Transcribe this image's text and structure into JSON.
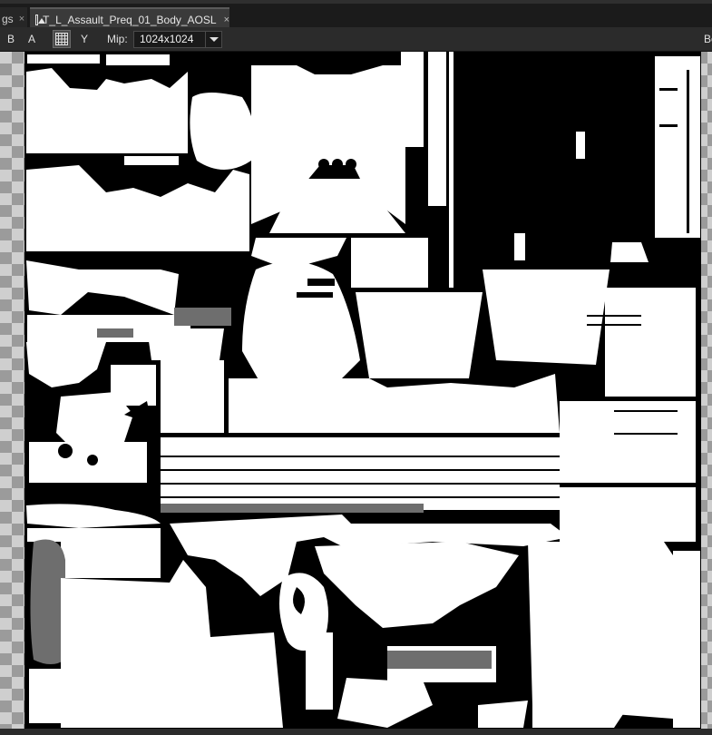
{
  "tabs": {
    "previous": {
      "label": "gs",
      "close": "×"
    },
    "active": {
      "label": "T_L_Assault_Preq_01_Body_AOSL",
      "close": "×",
      "icon": "image-icon"
    }
  },
  "toolbar": {
    "channel_b": "B",
    "channel_a": "A",
    "grid_toggle_icon": "grid-icon",
    "channel_y": "Y",
    "mip_label": "Mip:",
    "mip_value": "1024x1024",
    "right_cut_label": "Bo"
  },
  "viewport": {
    "background": "checkerboard",
    "texture_colors": {
      "bg": "#000000",
      "fill": "#ffffff",
      "gray": "#6e6e6e"
    }
  }
}
